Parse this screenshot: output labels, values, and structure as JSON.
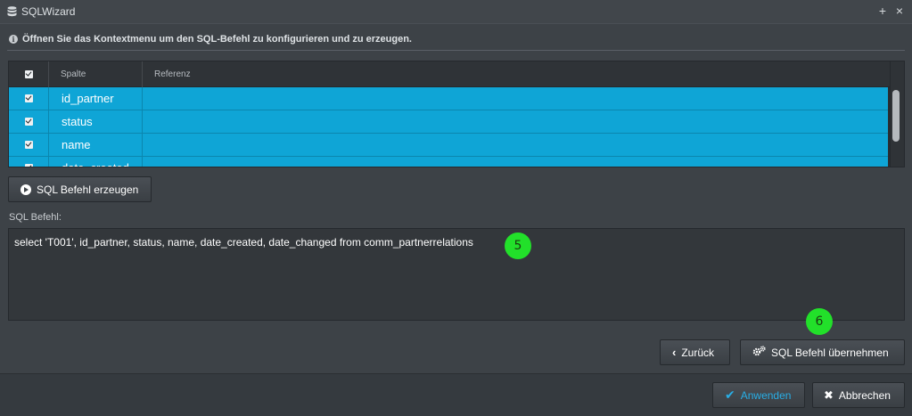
{
  "window": {
    "title": "SQLWizard",
    "icon": "database-icon",
    "maximize_label": "+",
    "close_label": "×"
  },
  "info": {
    "icon": "info-icon",
    "text": "Öffnen Sie das Kontextmenu um den SQL-Befehl zu konfigurieren und zu erzeugen."
  },
  "grid": {
    "columns": [
      "Spalte",
      "Referenz"
    ],
    "rows": [
      {
        "checked": true,
        "spalte": "id_partner",
        "referenz": ""
      },
      {
        "checked": true,
        "spalte": "status",
        "referenz": ""
      },
      {
        "checked": true,
        "spalte": "name",
        "referenz": ""
      },
      {
        "checked": true,
        "spalte": "date_created",
        "referenz": ""
      }
    ]
  },
  "generate_button": {
    "label": "SQL Befehl erzeugen",
    "icon": "play-circle-icon"
  },
  "sql": {
    "label": "SQL Befehl:",
    "value": "select 'T001', id_partner, status, name, date_created, date_changed from comm_partnerrelations"
  },
  "markers": {
    "sql_step": "5",
    "apply_step": "6"
  },
  "nav_buttons": {
    "back_label": "Zurück",
    "apply_sql_label": "SQL Befehl übernehmen"
  },
  "footer": {
    "apply_label": "Anwenden",
    "cancel_label": "Abbrechen"
  },
  "colors": {
    "selection": "#0fa5d6",
    "marker": "#22e02a",
    "apply_text": "#29aee6"
  }
}
